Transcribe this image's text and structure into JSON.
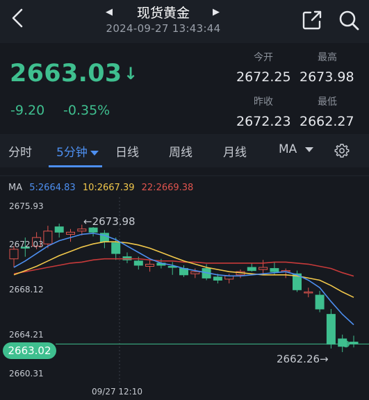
{
  "header": {
    "title": "现货黄金",
    "datetime": "2024-09-27 13:43:44"
  },
  "quote": {
    "price": "2663.03",
    "direction_arrow": "↓",
    "change": "-9.20",
    "change_pct": "-0.35%",
    "open_label": "今开",
    "open": "2672.25",
    "high_label": "最高",
    "high": "2673.98",
    "prev_close_label": "昨收",
    "prev_close": "2672.23",
    "low_label": "最低",
    "low": "2662.27"
  },
  "tabs": [
    {
      "label": "分时"
    },
    {
      "label": "5分钟",
      "active": true
    },
    {
      "label": "日线"
    },
    {
      "label": "周线"
    },
    {
      "label": "月线"
    },
    {
      "label": "MA"
    }
  ],
  "chart": {
    "ma_label": "MA",
    "ma5": "5:2664.83",
    "ma10": "10:2667.39",
    "ma22": "22:2669.38",
    "y_ticks": [
      "2675.93",
      "2672.03",
      "2668.12",
      "2664.21",
      "2660.31"
    ],
    "current_price_tag": "2663.02",
    "x_label": "09/27 12:10",
    "high_annotation": "←2673.98",
    "low_annotation": "2662.26→"
  },
  "colors": {
    "up": "#e0544e",
    "down": "#3fbf8f",
    "ma5": "#4d8ff0",
    "ma10": "#f2c84b",
    "ma22": "#c83a3a",
    "accent": "#4d8ff0"
  },
  "chart_data": {
    "type": "candlestick",
    "ylim": [
      2660.31,
      2675.93
    ],
    "candles": [
      {
        "o": 2671.0,
        "h": 2672.2,
        "l": 2670.2,
        "c": 2671.9
      },
      {
        "o": 2672.1,
        "h": 2673.0,
        "l": 2671.2,
        "c": 2672.0
      },
      {
        "o": 2672.2,
        "h": 2673.5,
        "l": 2671.9,
        "c": 2673.0
      },
      {
        "o": 2672.4,
        "h": 2674.1,
        "l": 2672.0,
        "c": 2673.6
      },
      {
        "o": 2674.0,
        "h": 2674.3,
        "l": 2673.0,
        "c": 2673.5
      },
      {
        "o": 2673.3,
        "h": 2673.8,
        "l": 2672.6,
        "c": 2673.5
      },
      {
        "o": 2673.6,
        "h": 2674.2,
        "l": 2673.2,
        "c": 2673.8
      },
      {
        "o": 2673.9,
        "h": 2673.98,
        "l": 2673.1,
        "c": 2673.5
      },
      {
        "o": 2673.4,
        "h": 2673.7,
        "l": 2672.0,
        "c": 2672.6
      },
      {
        "o": 2672.5,
        "h": 2673.0,
        "l": 2670.9,
        "c": 2671.5
      },
      {
        "o": 2671.2,
        "h": 2671.6,
        "l": 2670.6,
        "c": 2670.9
      },
      {
        "o": 2670.8,
        "h": 2671.2,
        "l": 2670.0,
        "c": 2670.4
      },
      {
        "o": 2670.3,
        "h": 2670.9,
        "l": 2669.8,
        "c": 2670.5
      },
      {
        "o": 2670.6,
        "h": 2671.0,
        "l": 2670.1,
        "c": 2670.4
      },
      {
        "o": 2670.3,
        "h": 2670.7,
        "l": 2669.5,
        "c": 2670.2
      },
      {
        "o": 2670.1,
        "h": 2670.4,
        "l": 2669.3,
        "c": 2669.5
      },
      {
        "o": 2669.6,
        "h": 2670.1,
        "l": 2669.2,
        "c": 2669.8
      },
      {
        "o": 2670.1,
        "h": 2670.5,
        "l": 2669.0,
        "c": 2669.2
      },
      {
        "o": 2669.3,
        "h": 2669.6,
        "l": 2668.7,
        "c": 2669.0
      },
      {
        "o": 2669.1,
        "h": 2669.6,
        "l": 2668.7,
        "c": 2669.4
      },
      {
        "o": 2669.5,
        "h": 2670.0,
        "l": 2669.2,
        "c": 2669.8
      },
      {
        "o": 2670.2,
        "h": 2670.6,
        "l": 2669.8,
        "c": 2669.9
      },
      {
        "o": 2670.0,
        "h": 2670.9,
        "l": 2669.6,
        "c": 2670.2
      },
      {
        "o": 2670.1,
        "h": 2670.7,
        "l": 2669.5,
        "c": 2669.8
      },
      {
        "o": 2669.8,
        "h": 2670.1,
        "l": 2669.2,
        "c": 2669.9
      },
      {
        "o": 2669.6,
        "h": 2669.9,
        "l": 2667.9,
        "c": 2668.1
      },
      {
        "o": 2667.8,
        "h": 2668.3,
        "l": 2667.4,
        "c": 2667.9
      },
      {
        "o": 2667.6,
        "h": 2668.0,
        "l": 2666.0,
        "c": 2666.3
      },
      {
        "o": 2665.8,
        "h": 2666.3,
        "l": 2662.6,
        "c": 2663.0
      },
      {
        "o": 2663.5,
        "h": 2663.9,
        "l": 2662.26,
        "c": 2662.8
      },
      {
        "o": 2663.2,
        "h": 2663.8,
        "l": 2662.7,
        "c": 2663.02
      }
    ],
    "ma5": [
      2670.2,
      2670.8,
      2671.5,
      2672.2,
      2672.7,
      2673.0,
      2673.3,
      2673.4,
      2673.2,
      2672.8,
      2672.2,
      2671.6,
      2671.0,
      2670.6,
      2670.4,
      2670.1,
      2669.9,
      2669.7,
      2669.5,
      2669.4,
      2669.4,
      2669.5,
      2669.6,
      2669.7,
      2669.8,
      2669.5,
      2669.0,
      2668.3,
      2667.0,
      2665.8,
      2664.83
    ],
    "ma10": [
      2669.5,
      2669.9,
      2670.3,
      2670.8,
      2671.3,
      2671.7,
      2672.1,
      2672.4,
      2672.6,
      2672.6,
      2672.5,
      2672.3,
      2672.0,
      2671.6,
      2671.2,
      2670.8,
      2670.5,
      2670.2,
      2670.0,
      2669.8,
      2669.7,
      2669.6,
      2669.5,
      2669.5,
      2669.5,
      2669.4,
      2669.2,
      2669.0,
      2668.5,
      2667.9,
      2667.39
    ],
    "ma22": [
      2669.6,
      2669.8,
      2670.0,
      2670.2,
      2670.4,
      2670.6,
      2670.7,
      2670.9,
      2671.0,
      2671.0,
      2671.0,
      2671.0,
      2670.9,
      2670.8,
      2670.8,
      2670.7,
      2670.7,
      2670.6,
      2670.6,
      2670.6,
      2670.6,
      2670.6,
      2670.6,
      2670.7,
      2670.7,
      2670.6,
      2670.5,
      2670.3,
      2670.1,
      2669.7,
      2669.38
    ],
    "current": 2663.02
  }
}
